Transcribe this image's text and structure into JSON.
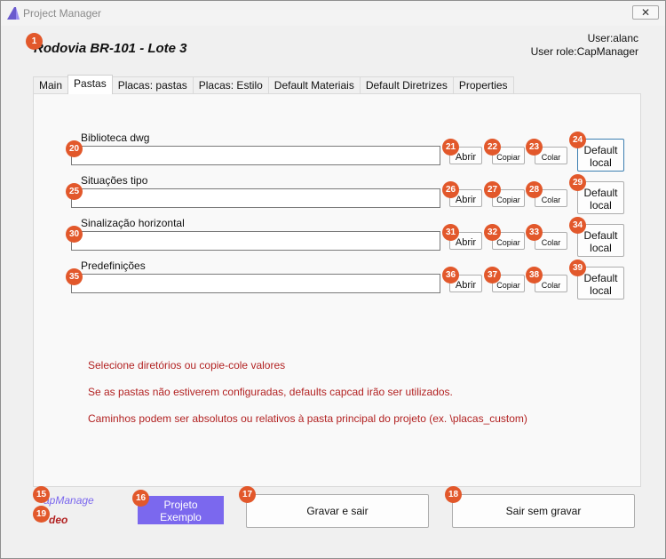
{
  "window": {
    "title": "Project Manager",
    "close_glyph": "✕"
  },
  "header": {
    "project_title": "Rodovia BR-101 - Lote 3",
    "user": "User:alanc",
    "user_role": "User role:CapManager"
  },
  "tabs": [
    {
      "label": "Main"
    },
    {
      "label": "Pastas"
    },
    {
      "label": "Placas: pastas"
    },
    {
      "label": "Placas: Estilo"
    },
    {
      "label": "Default Materiais"
    },
    {
      "label": "Default Diretrizes"
    },
    {
      "label": "Properties"
    }
  ],
  "active_tab": "Pastas",
  "fields": [
    {
      "label": "Biblioteca dwg",
      "value": ""
    },
    {
      "label": "Situações tipo",
      "value": ""
    },
    {
      "label": "Sinalização horizontal",
      "value": ""
    },
    {
      "label": "Predefinições",
      "value": ""
    }
  ],
  "field_buttons": {
    "abrir": "Abrir",
    "copiar": "Copiar",
    "colar": "Colar",
    "default_line1": "Default",
    "default_line2": "local"
  },
  "info_lines": [
    "Selecione diretórios ou copie-cole valores",
    "Se as pastas não estiverem configuradas, defaults capcad irão ser utilizados.",
    "Caminhos podem ser absolutos ou relativos à pasta principal do projeto (ex. \\placas_custom)"
  ],
  "footer": {
    "capmanage_link": "apManage",
    "video_link": "deo",
    "projeto_line1": "Projeto",
    "projeto_line2": "Exemplo",
    "save_exit": "Gravar e sair",
    "exit_no_save": "Sair sem gravar"
  },
  "badges": {
    "b1": "1",
    "b15": "15",
    "b16": "16",
    "b17": "17",
    "b18": "18",
    "b19": "19",
    "b20": "20",
    "b21": "21",
    "b22": "22",
    "b23": "23",
    "b24": "24",
    "b25": "25",
    "b26": "26",
    "b27": "27",
    "b28": "28",
    "b29": "29",
    "b30": "30",
    "b31": "31",
    "b32": "32",
    "b33": "33",
    "b34": "34",
    "b35": "35",
    "b36": "36",
    "b37": "37",
    "b38": "38",
    "b39": "39"
  },
  "colors": {
    "accent": "#7b68ee",
    "warning_text": "#b22222",
    "badge": "#e2582b",
    "focus_border": "#3c7fb1"
  }
}
